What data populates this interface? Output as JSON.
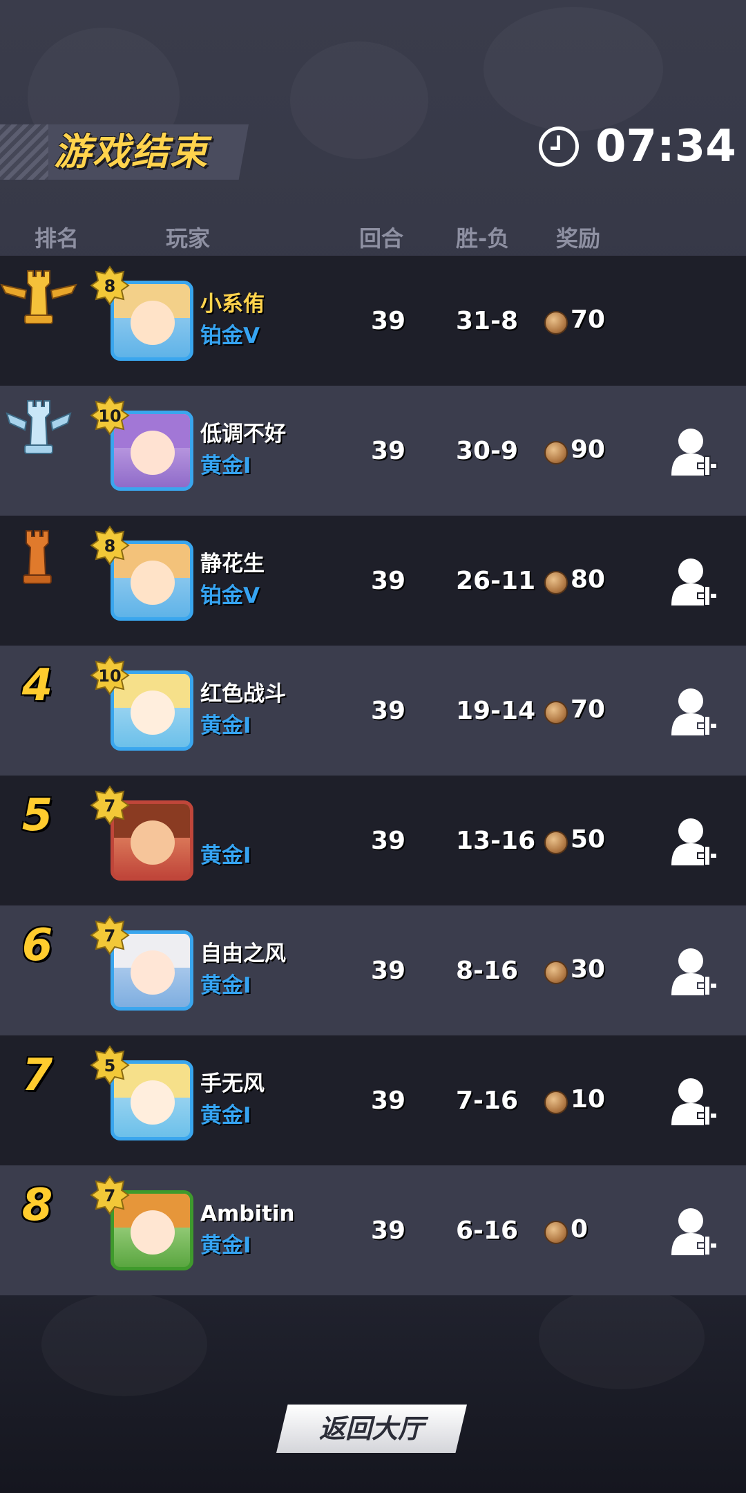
{
  "header": {
    "title": "游戏结束",
    "timer": "07:34",
    "clock_icon": "clock-icon"
  },
  "columns": {
    "rank": "排名",
    "player": "玩家",
    "rounds": "回合",
    "win_loss": "胜-负",
    "reward": "奖励"
  },
  "players": [
    {
      "rank": "1",
      "rank_icon": "gold-trophy-icon",
      "level": "8",
      "name": "小系侑",
      "tier": "铂金V",
      "rounds": "39",
      "win_loss": "31-8",
      "reward": "70",
      "add_friend": false
    },
    {
      "rank": "2",
      "rank_icon": "silver-trophy-icon",
      "level": "10",
      "name": "低调不好",
      "tier": "黄金I",
      "rounds": "39",
      "win_loss": "30-9",
      "reward": "90",
      "add_friend": true
    },
    {
      "rank": "3",
      "rank_icon": "bronze-trophy-icon",
      "level": "8",
      "name": "静花生",
      "tier": "铂金V",
      "rounds": "39",
      "win_loss": "26-11",
      "reward": "80",
      "add_friend": true
    },
    {
      "rank": "4",
      "level": "10",
      "name": "红色战斗",
      "tier": "黄金I",
      "rounds": "39",
      "win_loss": "19-14",
      "reward": "70",
      "add_friend": true
    },
    {
      "rank": "5",
      "level": "7",
      "name": "",
      "tier": "黄金I",
      "rounds": "39",
      "win_loss": "13-16",
      "reward": "50",
      "add_friend": true
    },
    {
      "rank": "6",
      "level": "7",
      "name": "自由之风",
      "tier": "黄金I",
      "rounds": "39",
      "win_loss": "8-16",
      "reward": "30",
      "add_friend": true
    },
    {
      "rank": "7",
      "level": "5",
      "name": "手无风",
      "tier": "黄金I",
      "rounds": "39",
      "win_loss": "7-16",
      "reward": "10",
      "add_friend": true
    },
    {
      "rank": "8",
      "level": "7",
      "name": "Ambitin",
      "tier": "黄金I",
      "rounds": "39",
      "win_loss": "6-16",
      "reward": "0",
      "add_friend": true
    }
  ],
  "footer": {
    "return_label": "返回大厅"
  },
  "colors": {
    "gold_text": "#ffd34d",
    "tier_blue": "#36a4f2",
    "row_dark": "#1e1f29",
    "row_light": "#3b3d4d"
  }
}
